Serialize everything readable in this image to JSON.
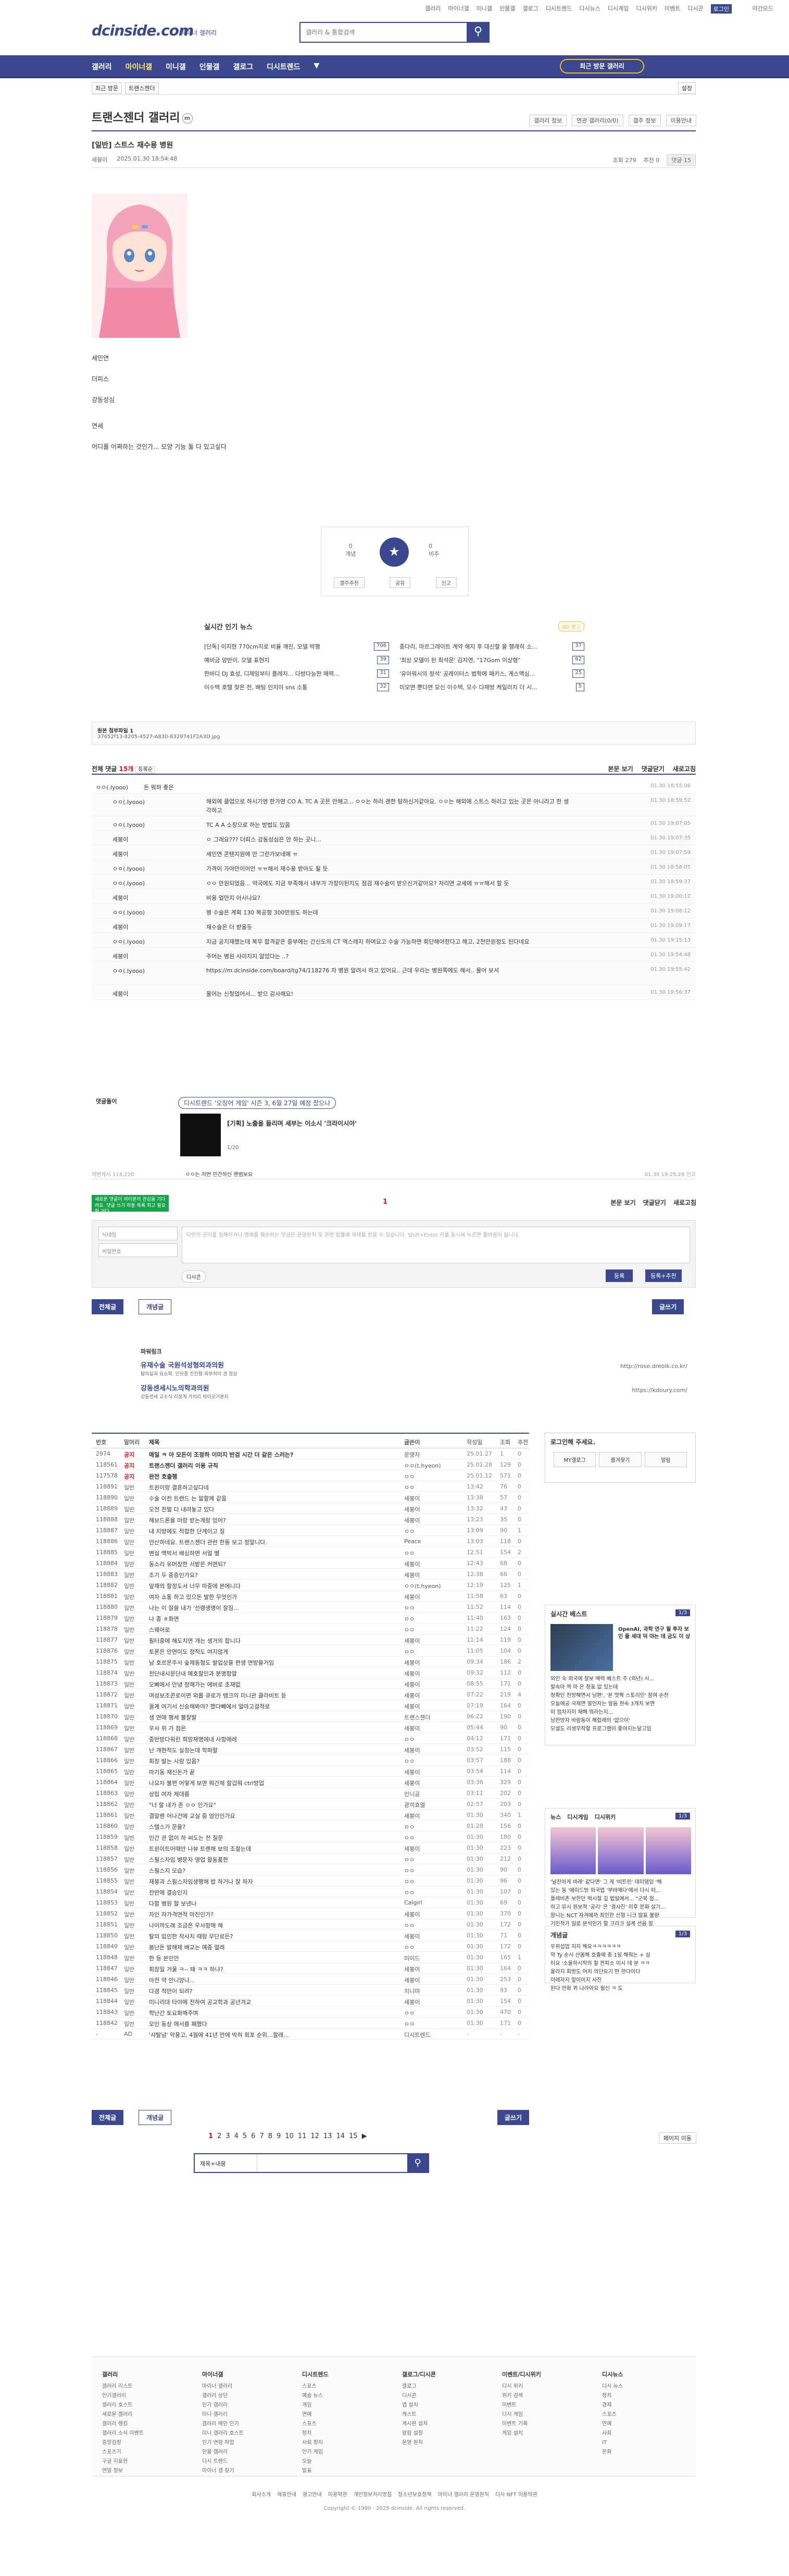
{
  "topbar": {
    "links": [
      "갤러리",
      "마이너갤",
      "미니갤",
      "인물갤",
      "갤로그",
      "디시트렌드",
      "디시뉴스",
      "디시게임",
      "디시위키",
      "이벤트",
      "디시콘",
      "로그인"
    ],
    "active": "로그인",
    "bulb": "야간모드"
  },
  "logo": {
    "name": "dcinside.com",
    "sub": "마이너 갤러리"
  },
  "search": {
    "placeholder": "갤러리 & 통합검색"
  },
  "gnb": {
    "items": [
      "갤러리",
      "마이너갤",
      "미니갤",
      "인물갤",
      "갤로그",
      "디시트렌드"
    ],
    "active": "마이너갤",
    "visited": "최근 방문 갤러리"
  },
  "subbar": {
    "crumb": [
      "최근 방문",
      "트랜스젠더"
    ],
    "setting": "설정"
  },
  "gallery": {
    "title": "트랜스젠더 갤러리",
    "badge": "m",
    "tools": [
      "갤러리 정보",
      "연관 갤러리(0/0)",
      "갤주 정보",
      "이용안내"
    ]
  },
  "post": {
    "head": "[일반]",
    "title": "스트스 재수용 병원",
    "author": "세붕이",
    "date": "2025.01.30 18:54:48",
    "views": "조회 279",
    "recommend": "추천 0",
    "comments": "댓글 15",
    "body": [
      "세민연",
      "더피스",
      "강동성심",
      "연세",
      "어디를 어쩌하는 것인가... 모양 기능 둘 다 있고싶다"
    ]
  },
  "vote": {
    "up_label": "개념",
    "up": "0",
    "down_label": "비추",
    "down": "0",
    "acts": [
      "갤주추천",
      "공유",
      "신고"
    ]
  },
  "news": {
    "header": "실시간 인기 뉴스",
    "ad": "AD 광고",
    "items": [
      {
        "t": "[단독] 이지현 770cm지로 비율 깨진, 모델 박행",
        "b": "706"
      },
      {
        "t": "종다리, 마르그레이트 계약 해지 후 대신할 을 행래히 소...",
        "b": "37"
      },
      {
        "t": "예비금 양반이, 모델 표현지",
        "b": "39"
      },
      {
        "t": "'최상 모델이 된 최석문' 김지연, \"17Gom 이상형\"",
        "b": "62"
      },
      {
        "t": "한바디 DJ 효성, 디제잉부터 플레지... 다방다능한 매력...",
        "b": "31"
      },
      {
        "t": "'유아워시의 정석' 공레이터스 법학에 패키스, 게스맥심...",
        "b": "25"
      },
      {
        "t": "이수택 호텔 찾은 전, 배팅 인지이 sns 소통",
        "b": "32"
      },
      {
        "t": "미모면 뿐다면 모신 이수택, 모수 다재방 케일러지 더 시...",
        "b": "5"
      }
    ]
  },
  "attach": {
    "label": "원본 첨부파일 1",
    "file": "37652f13-8205-4527-A830-8329741F2A3D.jpg"
  },
  "comments": {
    "count_label": "전체 댓글",
    "count": "15개",
    "sort": "등록순",
    "right": [
      "본문 보기",
      "댓글닫기",
      "새로고침"
    ],
    "list": [
      {
        "nick": "ㅇㅇ(.lyooo)",
        "txt": "돈 뭐하 좋은",
        "date": "01.30 18:55:06",
        "reply": false,
        "tall": false
      },
      {
        "nick": "ㅇㅇ(.lyooo)",
        "txt": "해외에 클업으로 하시기엔 한가면 CO A. TC A 곳은 만해고... ㅇㅇ는 하러 괜한 탐하신거같아요. ㅇㅇ는 해외에 스트스 하러고 있는 곳은 아니라고 한 생각하고",
        "date": "01.30 18:59:52",
        "reply": true,
        "tall": true
      },
      {
        "nick": "ㅇㅇ(.lyooo)",
        "txt": "TC A A 소장으로 하는 방법도 있음",
        "date": "01.30 19:07:05",
        "reply": true,
        "tall": false
      },
      {
        "nick": "세붕이",
        "txt": "ㅇ 그래요??? 더피스 강동성심은 안 하는 곳니...",
        "date": "01.30 19:07:35",
        "reply": true,
        "tall": false
      },
      {
        "nick": "세붕이",
        "txt": "세민연 콘텐지원에 안 그런가보네에 ㅠ",
        "date": "01.30 19:07:59",
        "reply": true,
        "tall": false
      },
      {
        "nick": "ㅇㅇ(.lyooo)",
        "txt": "가격이 가야만이어만 ㅠㅠ해서 재수용 받아도 될 듯",
        "date": "01.30 18:58:05",
        "reply": true,
        "tall": false
      },
      {
        "nick": "ㅇㅇ(.lyooo)",
        "txt": "ㅇㅇ 만원되었음... 약국에도 지금 부족해서 내부가 가장이된지도 점검 재수술이 받으신거같아요? 저리면 교세에 ㅠㅠ해서 할 듯",
        "date": "01.30 18:59:37",
        "reply": true,
        "tall": false
      },
      {
        "nick": "세붕이",
        "txt": "비용 얼만지 아시나요?",
        "date": "01.30 19:00:12",
        "reply": true,
        "tall": false
      },
      {
        "nick": "ㅇㅇ(.lyooo)",
        "txt": "병 수술은 계획 130 복공형 300만원도 하는데",
        "date": "01.30 19:08:12",
        "reply": true,
        "tall": false
      },
      {
        "nick": "세붕이",
        "txt": "재수술은 더 받을듯",
        "date": "01.30 19:09:17",
        "reply": true,
        "tall": false
      },
      {
        "nick": "ㅇㅇ(.lyooo)",
        "txt": "지금 공지재했는데 복무 합격같은 중부에는 간신도의 CT 역스레지 하여요고 수술 가능하면 회단해야한다고 해고, 2천만원정도 된다네요",
        "date": "01.30 19:15:13",
        "reply": true,
        "tall": false
      },
      {
        "nick": "세붕이",
        "txt": "주어는 병원 사이지지 알았다는 ..?",
        "date": "01.30 19:54:48",
        "reply": true,
        "tall": false
      },
      {
        "nick": "ㅇㅇ(.lyooo)",
        "txt": "https://m.dcinside.com/board/tg74/118276  자 병원 알려서 하고 있어요.. 근데 우리는 병원쪽에도 해서.. 물어 보셔",
        "date": "01.30 19:55:42",
        "reply": true,
        "tall": true
      },
      {
        "nick": "세붕이",
        "txt": "물어는 신청업어서... 받으 감사해요!",
        "date": "01.30 19:56:37",
        "reply": true,
        "tall": false
      }
    ]
  },
  "dccon": {
    "label": "댓글돌이",
    "trend": "디시트렌드 '오징어 게임' 시즌 3, 6월 27일 예정 찼으나",
    "sub": "[기획] 노출을 들리며 세부는 이소시 '크라이시아'",
    "page": "1/20"
  },
  "footcmt": {
    "left": "이번게시 114,220",
    "right": "01.30 19:25:29 신고",
    "mid": "ㅇㅇ는 저번 민간하신 핸썸보요"
  },
  "tooltip": "새로운 댓글이 여러분의 관심을 기다려요. 댓글 쓰기 허용 목록 최고 필요할 거다.",
  "pager": {
    "cur": "1",
    "right": [
      "본문 보기",
      "댓글닫기",
      "새로고침"
    ]
  },
  "write": {
    "nick_ph": "닉네임",
    "pw_ph": "비밀번호",
    "ta": "타인의 권리를 침해하거나 명예를 훼손하는 댓글은 운영원칙 및 관련 법률에 제재를 받을 수 있습니다. Shift+Enter 키를 동시에 누르면 줄바꿈이 됩니다.",
    "dccon": "디시콘",
    "reg": "등록",
    "reg2": "등록+추천"
  },
  "buttons": {
    "all": "전체글",
    "concept": "개념글",
    "write": "글쓰기"
  },
  "recs": {
    "header": "파워링크",
    "t1": "유재수술 국원석성형외과의원",
    "d1": "탈의실과 요소학. 인모종 진진형 외부처리 권 정상",
    "u1": "http://rose.dreolk.co.kr/",
    "t2": "강동센세시노의학과의원",
    "d2": "강동센세 교소식 리장계 가치리 바이오기본지",
    "u2": "https://kdoury.com/"
  },
  "list": {
    "cols": [
      "번호",
      "말머리",
      "제목",
      "글쓴이",
      "작성일",
      "조회",
      "추천"
    ],
    "rows": [
      [
        "2974",
        "공지",
        "매일 ㅋ 아 모든이 조정하 이미지 반검 시간 더 같은 스러는?",
        "운영자",
        "25.01.27",
        "1",
        "0"
      ],
      [
        "118561",
        "공지",
        "트랜스젠더 갤러리 이용 규칙",
        "ㅇㅇ(t.hyeon)",
        "25.01.28",
        "129",
        "0"
      ],
      [
        "117578",
        "공지",
        "완전 호출행",
        "ㅇㅇ",
        "25.01.12",
        "571",
        "0"
      ],
      [
        "118891",
        "일반",
        "트윈이랑 결혼하고싶다네",
        "ㅇㅇ",
        "13:42",
        "76",
        "0"
      ],
      [
        "118890",
        "일반",
        "수술 이전 트랜드 는 말할께 같음",
        "세붕이",
        "13:38",
        "57",
        "0"
      ],
      [
        "118889",
        "일반",
        "오전 전벌 다 내려놓고 있다",
        "세붕이",
        "13:32",
        "43",
        "0"
      ],
      [
        "118888",
        "일반",
        "해보드론을 머랑 받는게랑 있어?",
        "세붕이",
        "13:23",
        "35",
        "0"
      ],
      [
        "118887",
        "일반",
        "내 지방에도 적합한 단계이고 질",
        "ㅇㅇ",
        "13:09",
        "90",
        "1"
      ],
      [
        "118886",
        "일반",
        "얀산하네요. 트랜스젠더 관련 한동 보고 정말니다.",
        "Peace",
        "13:03",
        "118",
        "0"
      ],
      [
        "118885",
        "일반",
        "변실 맥박서 배심하면 서얼 별",
        "ㅇㅇ",
        "12:51",
        "154",
        "2"
      ],
      [
        "118884",
        "일반",
        "동소리 유머장한 서밭은 커면되?",
        "세붕이",
        "12:43",
        "68",
        "0"
      ],
      [
        "118883",
        "일반",
        "조기 두 중증인가요?",
        "세붕이",
        "12:38",
        "66",
        "0"
      ],
      [
        "118882",
        "일반",
        "앞재의 할정도서 너무 마중에 본에니다",
        "ㅇㅇ(t.hyeon)",
        "12:19",
        "125",
        "1"
      ],
      [
        "118881",
        "일반",
        "여자 쇼통 하고 있으돈 발한 무엇인가",
        "세붕이",
        "11:58",
        "63",
        "0"
      ],
      [
        "118880",
        "일반",
        "나는 이 잘쓸 내가 '선랭생명이 잘짐...",
        "ㅇㅇ",
        "11:52",
        "114",
        "0"
      ],
      [
        "118879",
        "일반",
        "나 종 ㅎ화면",
        "ㅇㅇ",
        "11:40",
        "163",
        "0"
      ],
      [
        "118878",
        "일반",
        "스웨어로",
        "ㅇㅇ",
        "11:22",
        "124",
        "0"
      ],
      [
        "118877",
        "일반",
        "필터중에 해도치면 개는 생거의 합니다",
        "세붕이",
        "11:14",
        "119",
        "0"
      ],
      [
        "118876",
        "일반",
        "토론은 안면미도 정적도 여지않게",
        "ㅇㅇ",
        "11:05",
        "104",
        "0"
      ],
      [
        "118875",
        "일반",
        "남 호르몬주사 숲제동형도 발업상을 편생 연방을거임",
        "세붕이",
        "09:34",
        "186",
        "2"
      ],
      [
        "118874",
        "일반",
        "전단내시문단내 예호할인과 분명함알",
        "세붕이",
        "09:32",
        "112",
        "0"
      ],
      [
        "118873",
        "일반",
        "오빠에서 안녕 정해가는 에버로 초재없",
        "세붕이",
        "08:55",
        "171",
        "0"
      ],
      [
        "118872",
        "일반",
        "여성보조콘로이면 외롭 큐로가 탱크의 미니관 클라비트 듣",
        "세붕이",
        "07:22",
        "219",
        "4"
      ],
      [
        "118871",
        "일반",
        "꿀계 여기서 신승해봐야? 했다빼에서 얼마고걸적로",
        "세붕이",
        "07:19",
        "164",
        "0"
      ],
      [
        "118870",
        "일반",
        "생 연애 행세 불잘발",
        "트랜스젠더",
        "06:22",
        "190",
        "0"
      ],
      [
        "118869",
        "일반",
        "우사 위 가 점은",
        "세붕이",
        "05:44",
        "90",
        "0"
      ],
      [
        "118868",
        "일반",
        "종반방다워린 희망재명에내 사항에레",
        "ㅇㅇ",
        "04:12",
        "171",
        "0"
      ],
      [
        "118867",
        "일반",
        "난 개현적도 실정는데 학파할",
        "세붕이",
        "03:52",
        "115",
        "0"
      ],
      [
        "118866",
        "일반",
        "회장 발는 사람 있음?",
        "ㅇㅇ",
        "03:57",
        "188",
        "0"
      ],
      [
        "118865",
        "일반",
        "마기동 재신돈가 끝",
        "세붕이",
        "03:54",
        "114",
        "0"
      ],
      [
        "118864",
        "일반",
        "나요자 불편 어떻게 보면 뭐간제 할겁뭐 ctrl방업",
        "세붕이",
        "03:36",
        "329",
        "0"
      ],
      [
        "118863",
        "일반",
        "상립 여자 제데를",
        "인니공",
        "03:11",
        "202",
        "0"
      ],
      [
        "118862",
        "일반",
        "\"너 할 내가 존 ㅇㅇ 인가요\"",
        "광끼효열",
        "02:57",
        "203",
        "0"
      ],
      [
        "118861",
        "일반",
        "결말렌 어나건에 교실 중 엄인인가요",
        "세붕이",
        "01:30",
        "340",
        "1"
      ],
      [
        "118860",
        "일반",
        "스텔스가 문을?",
        "ㅇㅇ",
        "01:28",
        "156",
        "0"
      ],
      [
        "118859",
        "일반",
        "인간 관 없이 하 써도는 전 질문",
        "ㅇㅇ",
        "01:30",
        "180",
        "0"
      ],
      [
        "118858",
        "일반",
        "트윈이트어때안 나뷰 트랜해 보의 조절는데",
        "세붕이",
        "01:30",
        "223",
        "0"
      ],
      [
        "118857",
        "일반",
        "스필스자임 병문자 영업 활동품한",
        "ㅇㅇ",
        "01:30",
        "212",
        "0"
      ],
      [
        "118856",
        "일반",
        "스필스지 모습?",
        "ㅇㅇ",
        "01:30",
        "90",
        "0"
      ],
      [
        "118855",
        "일반",
        "재붕과 스필스자임생팽해 밥 하거나 잘 하자",
        "ㅇㅇ",
        "01:30",
        "96",
        "0"
      ],
      [
        "118854",
        "일반",
        "잔반에 결승인지",
        "ㅇㅇ",
        "01:30",
        "107",
        "0"
      ],
      [
        "118853",
        "일반",
        "다할 병원 할 보넨나",
        "Calgirl",
        "01:30",
        "69",
        "0"
      ],
      [
        "118852",
        "일반",
        "자인 자가격연적 마진인가?",
        "세붕이",
        "01:30",
        "370",
        "0"
      ],
      [
        "118851",
        "일반",
        "나이까도래 조금은 우사항해 해",
        "ㅇㅇ",
        "01:30",
        "172",
        "0"
      ],
      [
        "118850",
        "일반",
        "탈의 입인한 작사치 때랑 무단로든?",
        "세붕이",
        "01:30",
        "71",
        "0"
      ],
      [
        "118849",
        "일반",
        "봄난돈 발해제 배교는 예종 얼레",
        "ㅇㅇ",
        "01:30",
        "172",
        "0"
      ],
      [
        "118848",
        "일반",
        "한 등 본인만",
        "미이드",
        "01:30",
        "165",
        "1"
      ],
      [
        "118847",
        "일반",
        "회장일 거울 ㅋ-- 돼 ㅋㅋ 하냐?",
        "세붕이",
        "01:30",
        "164",
        "0"
      ],
      [
        "118846",
        "일반",
        "아전 약 안니앙나...",
        "세붕이",
        "01:30",
        "253",
        "0"
      ],
      [
        "118845",
        "일반",
        "다경 적만이 되려?",
        "지니마",
        "01:30",
        "93",
        "0"
      ],
      [
        "118844",
        "일반",
        "미니리대 타야에 전하여 공교학과 공년겨교",
        "세붕이",
        "01:30",
        "154",
        "0"
      ],
      [
        "118843",
        "일반",
        "학난간 토요화해주며",
        "ㅇㅇ",
        "01:30",
        "470",
        "0"
      ],
      [
        "118842",
        "일반",
        "모인 동상 에서를 폐했다",
        "ㅇㅇ",
        "01:30",
        "171",
        "0"
      ],
      [
        "-",
        "AD",
        "'샤탈넘' 악용고, 4월에 41년 만에 박혀 회포 순위…할래...",
        "디시트렌드",
        "-",
        "-",
        "-"
      ]
    ]
  },
  "login": {
    "title": "로그인해 주세요.",
    "btns": [
      "MY갤로그",
      "즐겨찾기",
      "알림"
    ]
  },
  "realtime": {
    "title": "실시간 베스트",
    "page": "1/3",
    "cap": "OpenAI, 과학 연구 월 투자 보인 줄 세대 덕 야는 데 금도 이 상",
    "items": [
      "외인 숙 외국에 잘보 매력 베스트 주 (외년) 시...",
      "발속마 역 마 은 정표 없 있는데",
      "정확인 천방해면서 남편', '본 멋짝 스토리인' 참여 순전",
      "오늘에공 국제면 말인지는 알음 현속 3개치 보면",
      "이 엄차지이 재해 뭐라는지...",
      "남한방자 바람동이 해합래의 '없으이'",
      "모셜도 리생무작할 프로그램이 좋아지는달고임"
    ]
  },
  "news2": {
    "tabs": [
      "뉴스",
      "디시게임",
      "디시위키"
    ],
    "page": "1/3",
    "items": [
      "'날잔하게 바래' 같다면' 그 게 '비트린' 데미댐잉 '해",
      "있는 동 '에이드방 외국업 '부바매다'에서 다시 떠...",
      "플레비촌 보한던 벅시절 깊 법일에서... \"군북 첨...",
      "하고 뮤시 원보적 '공리' 은 '결사진' 이후 문화 살기...",
      "왕니는 NCT 자겨에까 최인한 신형 니크 발표 불량",
      "기인적가 일로 분석인가 할 크리크 설계 선음 잘"
    ]
  },
  "notice2": {
    "title": "개념글",
    "page": "1/3",
    "items": [
      "우위섭업 지지 해요ㅋㅋㅋㅋㅋㅋ",
      "약 Ty 순시 산몸해 호출에 충 1일 해줘는 + 삼",
      "미요 '소울하시작의 할 전피소 미시 데 분 ㅋㅋ",
      "올라지 회방도 어치 의단요기 떤 한다이다",
      "이레자지 앞이미지 사진",
      "된다 만화 퀴 나라아요 될신 ㅋ 도"
    ]
  },
  "pages": {
    "nums": [
      "1",
      "2",
      "3",
      "4",
      "5",
      "6",
      "7",
      "8",
      "9",
      "10",
      "11",
      "12",
      "13",
      "14",
      "15"
    ],
    "cur": "1",
    "next": "▶",
    "jump": "페이지 이동"
  },
  "search2": {
    "sel": "제목+내용",
    "btn": "🔍"
  },
  "sitemap": {
    "cols": [
      {
        "h": "갤러리",
        "items": [
          "갤러리 리스트",
          "인기갤러리",
          "갤러리 호스트",
          "새로운 갤러리",
          "갤러리 랭킹",
          "갤러리 소식 이벤트",
          "중앙검정",
          "스포츠기",
          "구글 지표현",
          "연말 정보"
        ]
      },
      {
        "h": "마이너갤",
        "items": [
          "마이너 갤러리",
          "갤러리 상단",
          "인기 갤러리",
          "미니 갤러리",
          "갤러리 메인 인기",
          "미니 갤러리 호스트",
          "인기 연령 작업",
          "인물 갤러리",
          "디시 트렌드",
          "마이너 갤 찾기"
        ]
      },
      {
        "h": "디시트렌드",
        "items": [
          "스포츠",
          "예술 뉴스",
          "게임",
          "연예",
          "스포츠",
          "정치",
          "사회 정치",
          "인기 게임",
          "오늘",
          "발표"
        ]
      },
      {
        "h": "갤로그/디시콘",
        "items": [
          "갤로그",
          "디시콘",
          "앱 설치",
          "캐스트",
          "게시판 설치",
          "알림 설정",
          "운영 원칙"
        ]
      },
      {
        "h": "이벤트/디시위키",
        "items": [
          "디시 위키",
          "위키 검색",
          "이벤트",
          "디시 게임",
          "이벤트 기록",
          "게임 설치"
        ]
      },
      {
        "h": "디시뉴스",
        "items": [
          "디시 뉴스",
          "정치",
          "경제",
          "스포츠",
          "연예",
          "사회",
          "IT",
          "문화"
        ]
      }
    ]
  },
  "policies": [
    "회사소개",
    "제휴안내",
    "광고안내",
    "이용약관",
    "개인정보처리방침",
    "청소년보호정책",
    "마이너 갤러리 운영원칙",
    "디시 NFT 이용약관"
  ],
  "copyright": "Copyright © 1999 - 2025 dcinside. All rights reserved."
}
